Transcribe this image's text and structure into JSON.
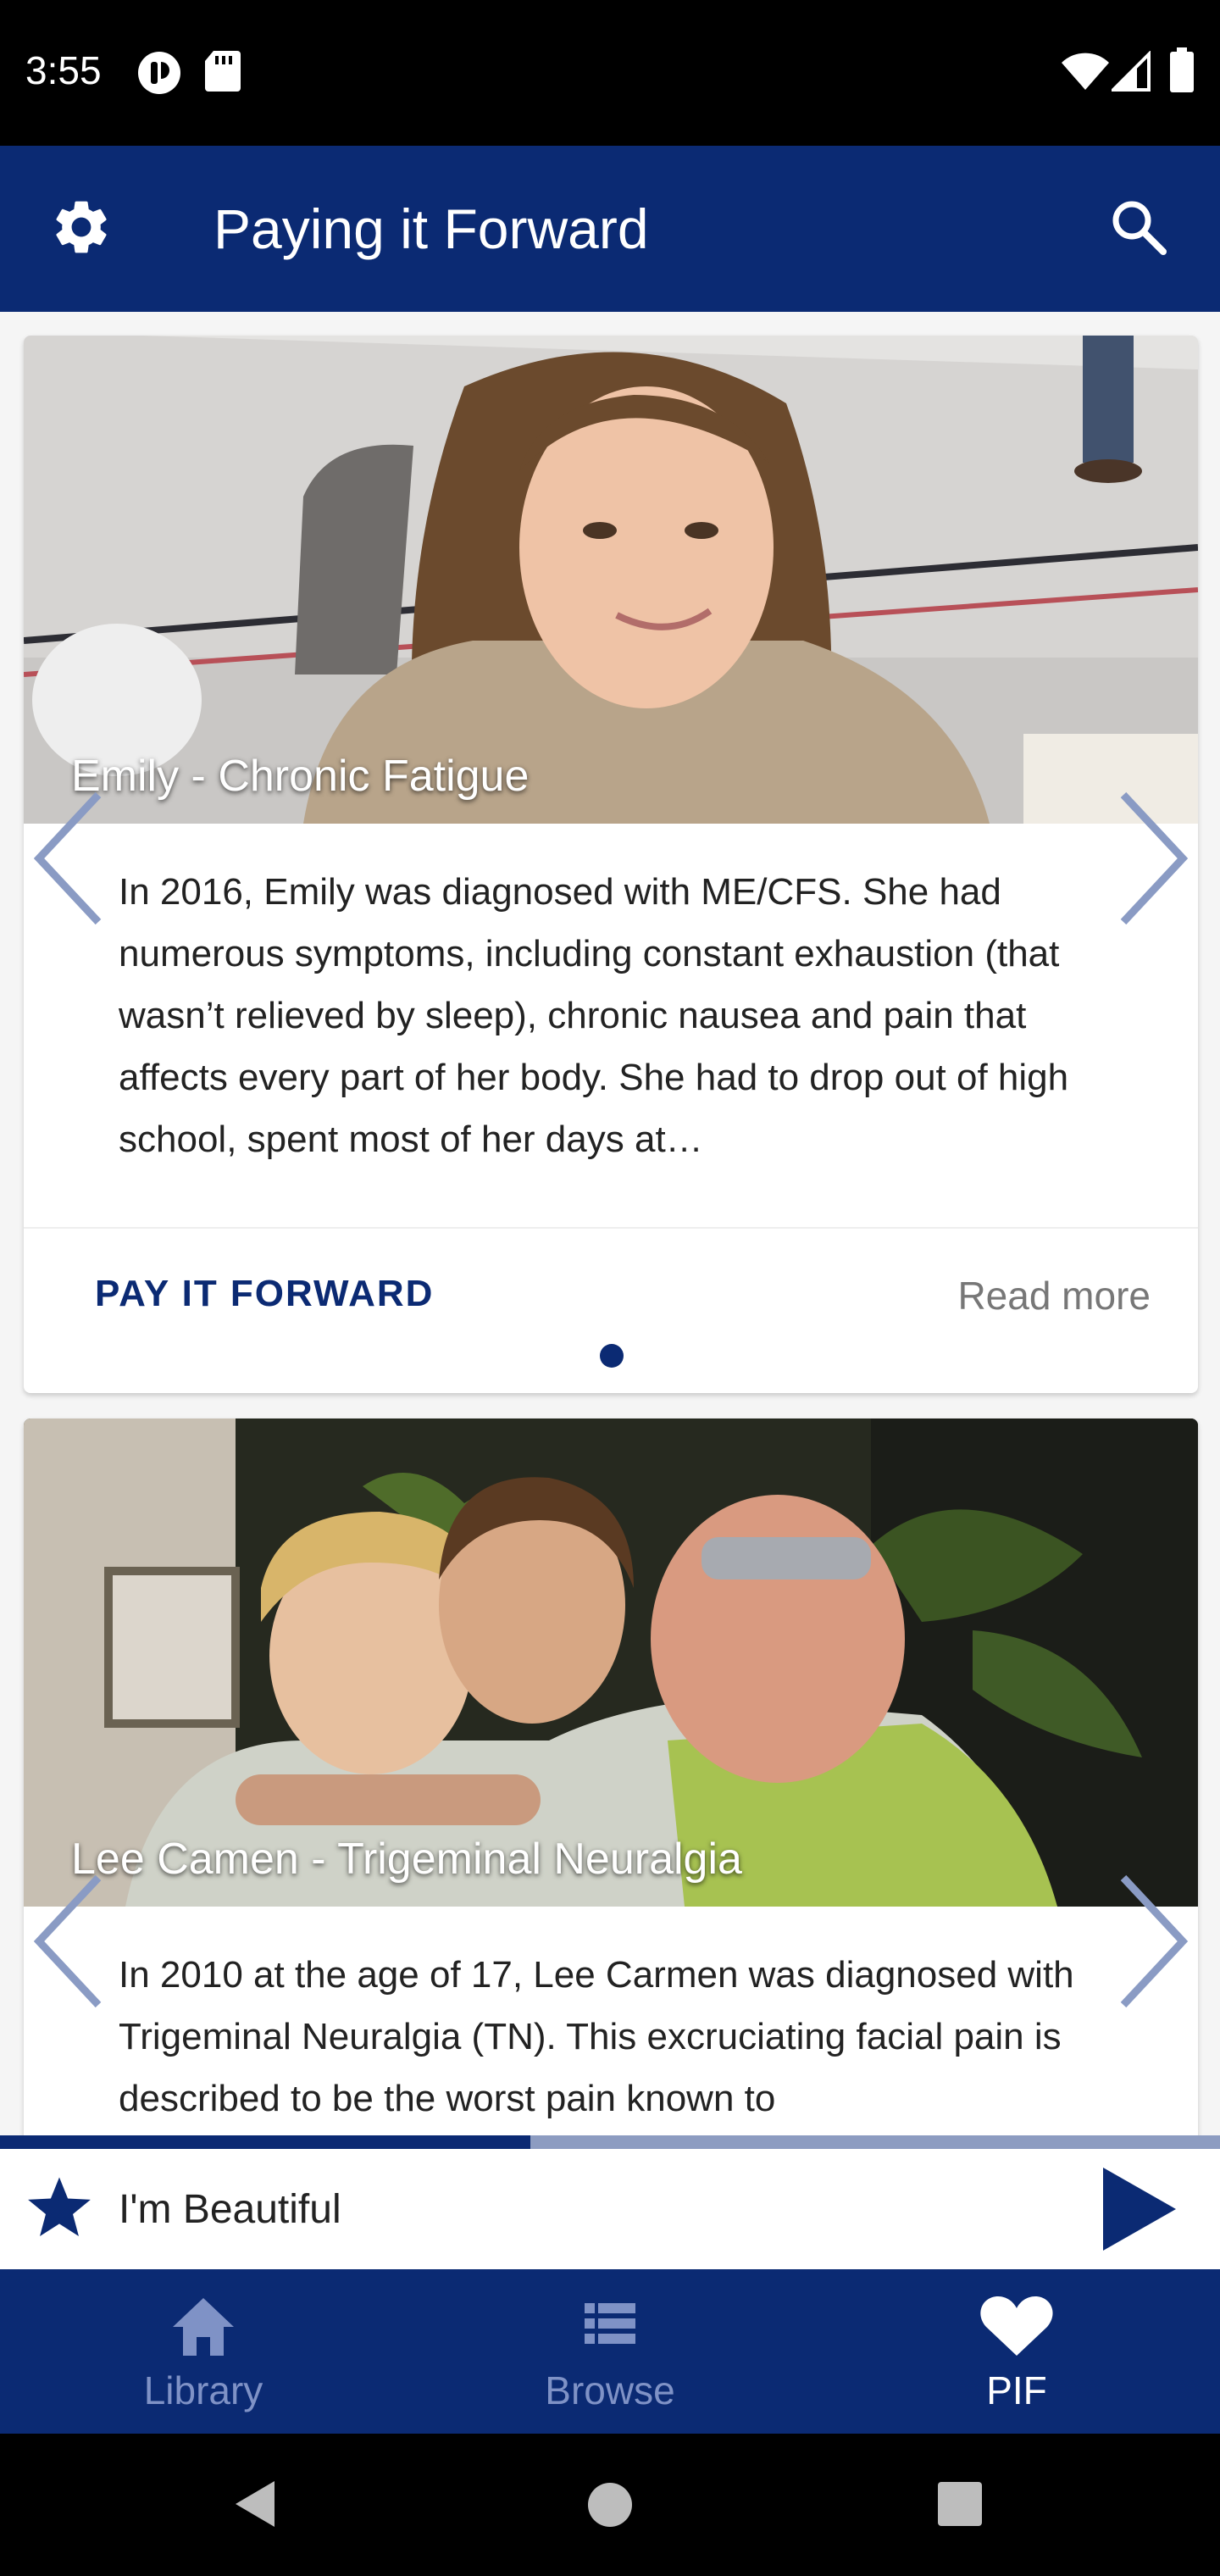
{
  "status_bar": {
    "time": "3:55",
    "icons": [
      "circle-notification-icon",
      "sd-card-icon",
      "wifi-icon",
      "signal-icon",
      "battery-icon"
    ]
  },
  "app_bar": {
    "title": "Paying it Forward",
    "left_icon": "gear-icon",
    "right_icon": "search-icon"
  },
  "stories": [
    {
      "title": "Emily - Chronic Fatigue",
      "text": "In 2016, Emily was diagnosed with ME/CFS. She had numerous symptoms, including constant exhaustion (that wasn’t relieved by sleep), chronic nausea and pain that affects every part of her body. She had to drop out of high school, spent most of her days at…",
      "pay_button": "PAY IT FORWARD",
      "read_more": "Read more"
    },
    {
      "title": "Lee Camen - Trigeminal Neuralgia",
      "text": "In 2010 at the age of 17, Lee Carmen was diagnosed with Trigeminal Neuralgia (TN). This excruciating facial pain is described to be the worst pain known to"
    }
  ],
  "player": {
    "title": "I'm Beautiful",
    "progress": 0.435,
    "left_icon": "star-icon",
    "right_icon": "play-icon"
  },
  "bottom_nav": {
    "items": [
      {
        "label": "Library",
        "icon": "home-icon"
      },
      {
        "label": "Browse",
        "icon": "list-icon"
      },
      {
        "label": "PIF",
        "icon": "heart-icon",
        "active": true
      }
    ]
  },
  "colors": {
    "brand": "#0b2a73",
    "progress_track": "#8d9cc1",
    "inactive_nav": "#7f92c6"
  }
}
